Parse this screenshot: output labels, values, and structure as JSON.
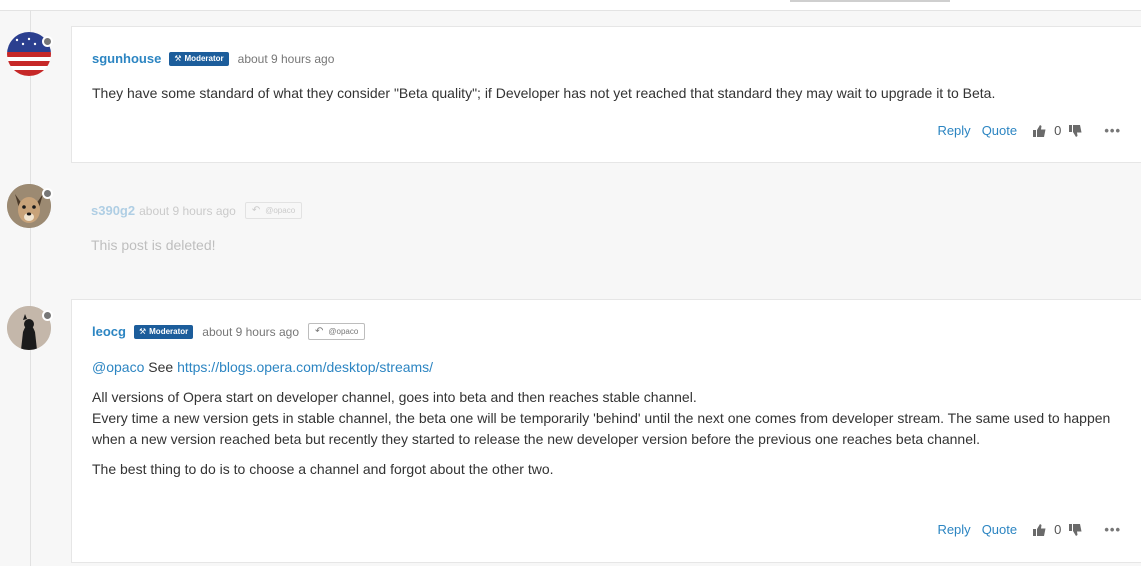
{
  "posts": [
    {
      "username": "sgunhouse",
      "badge": "Moderator",
      "time": "about 9 hours ago",
      "content": "They have some standard of what they consider \"Beta quality\"; if Developer has not yet reached that standard they may wait to upgrade it to Beta.",
      "actions": {
        "reply": "Reply",
        "quote": "Quote",
        "votes": "0",
        "more": "•••"
      }
    },
    {
      "username": "s390g2",
      "time": "about 9 hours ago",
      "reply_to": "@opaco",
      "content": "This post is deleted!"
    },
    {
      "username": "leocg",
      "badge": "Moderator",
      "time": "about 9 hours ago",
      "reply_to": "@opaco",
      "mention": "@opaco",
      "see_text": "See",
      "link": "https://blogs.opera.com/desktop/streams/",
      "paragraph1": "All versions of Opera start on developer channel, goes into beta and then reaches stable channel.",
      "paragraph2": "Every time a new version gets in stable channel, the beta one will be temporarily 'behind' until the next one comes from developer stream. The same used to happen when a new version reached beta but recently they started to release the new developer version before the previous one reaches beta channel.",
      "paragraph3": "The best thing to do is to choose a channel and forgot about the other two.",
      "actions": {
        "reply": "Reply",
        "quote": "Quote",
        "votes": "0",
        "more": "•••"
      }
    }
  ],
  "colors": {
    "link": "#2c85c2",
    "badge": "#1c5d9b",
    "text": "#333333",
    "meta": "#777777"
  },
  "icons": [
    "gavel-icon",
    "reply-arrow-icon",
    "thumbs-up-icon",
    "thumbs-down-icon",
    "more-icon",
    "status-dot-icon"
  ]
}
